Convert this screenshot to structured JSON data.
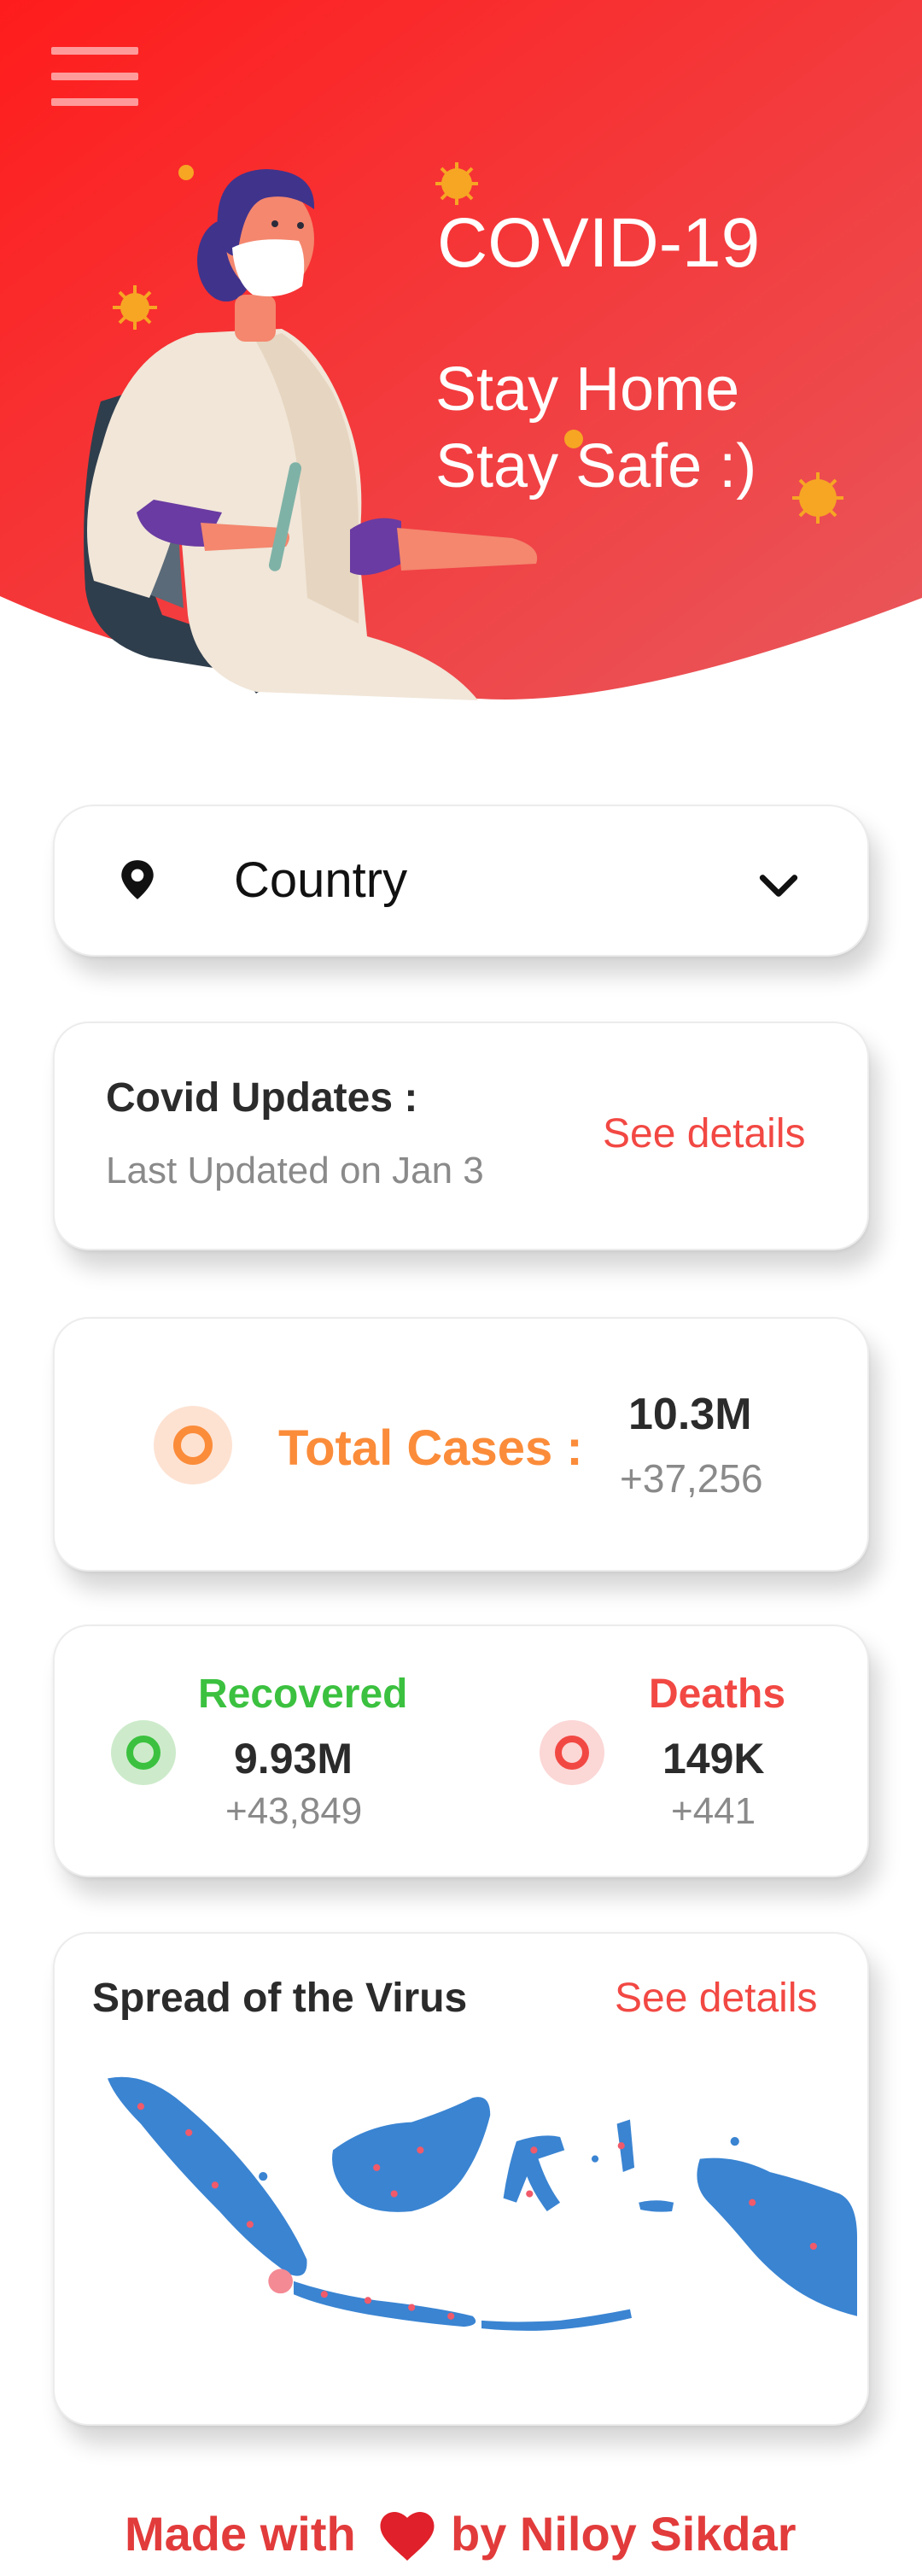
{
  "header": {
    "title": "COVID-19",
    "subtitle_line1": "Stay Home",
    "subtitle_line2": "Stay Safe :)",
    "menu_icon": "hamburger-menu-icon",
    "gradient_start": "#ff2020",
    "gradient_end": "#e9555a"
  },
  "country_select": {
    "icon": "location-pin-icon",
    "label": "Country",
    "dropdown_icon": "chevron-down-icon"
  },
  "updates": {
    "title": "Covid Updates :",
    "last_updated": "Last Updated on Jan 3",
    "link": "See details"
  },
  "total_cases": {
    "label": "Total Cases :",
    "value": "10.3M",
    "delta": "+37,256",
    "color": "#fb8c3a"
  },
  "recovered": {
    "label": "Recovered",
    "value": "9.93M",
    "delta": "+43,849",
    "color": "#3bc13f"
  },
  "deaths": {
    "label": "Deaths",
    "value": "149K",
    "delta": "+441",
    "color": "#f24843"
  },
  "spread": {
    "title": "Spread of the Virus",
    "link": "See details",
    "map_color": "#3a84d2"
  },
  "footer": {
    "text_before": "Made with",
    "heart_icon": "heart-icon",
    "text_after": "by Niloy Sikdar"
  }
}
